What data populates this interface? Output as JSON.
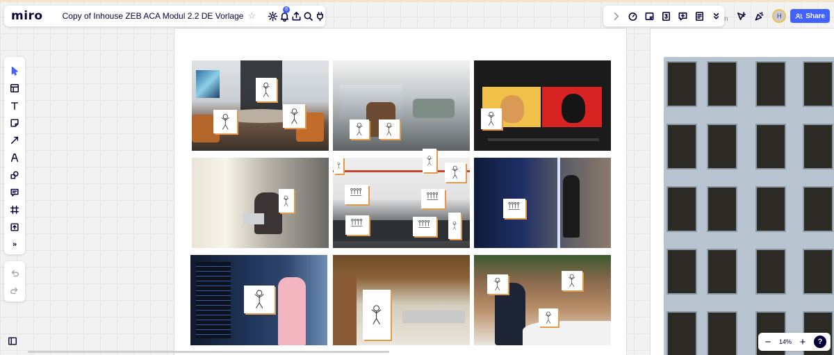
{
  "app": {
    "logo": "miro",
    "board_title": "Copy of Inhouse ZEB ACA Modul 2.2 DE Vorlage"
  },
  "toolbar_top": {
    "icons": [
      "gear-icon",
      "bell-icon",
      "upload-icon",
      "search-icon",
      "plug-icon"
    ],
    "notification_count": "8"
  },
  "toolbar_right": {
    "icons": [
      "chevron-right-icon",
      "timer-icon",
      "card-icon",
      "number-icon",
      "comment-icon",
      "notes-icon",
      "chevron-down-icon"
    ]
  },
  "collab": {
    "avatar_initial": "H",
    "share_label": "Share",
    "ghost_text": "n"
  },
  "left_tools": [
    "select",
    "templates",
    "text",
    "sticky-note",
    "arrow",
    "pen",
    "shapes",
    "comment",
    "frame",
    "upload",
    "more"
  ],
  "left_more_label": "»",
  "zoom": {
    "level": "14%",
    "minus": "−",
    "plus": "+",
    "help": "?"
  },
  "colors": {
    "accent": "#4262ff",
    "dark": "#050038",
    "sticky_shadow": "#e39a4e"
  }
}
